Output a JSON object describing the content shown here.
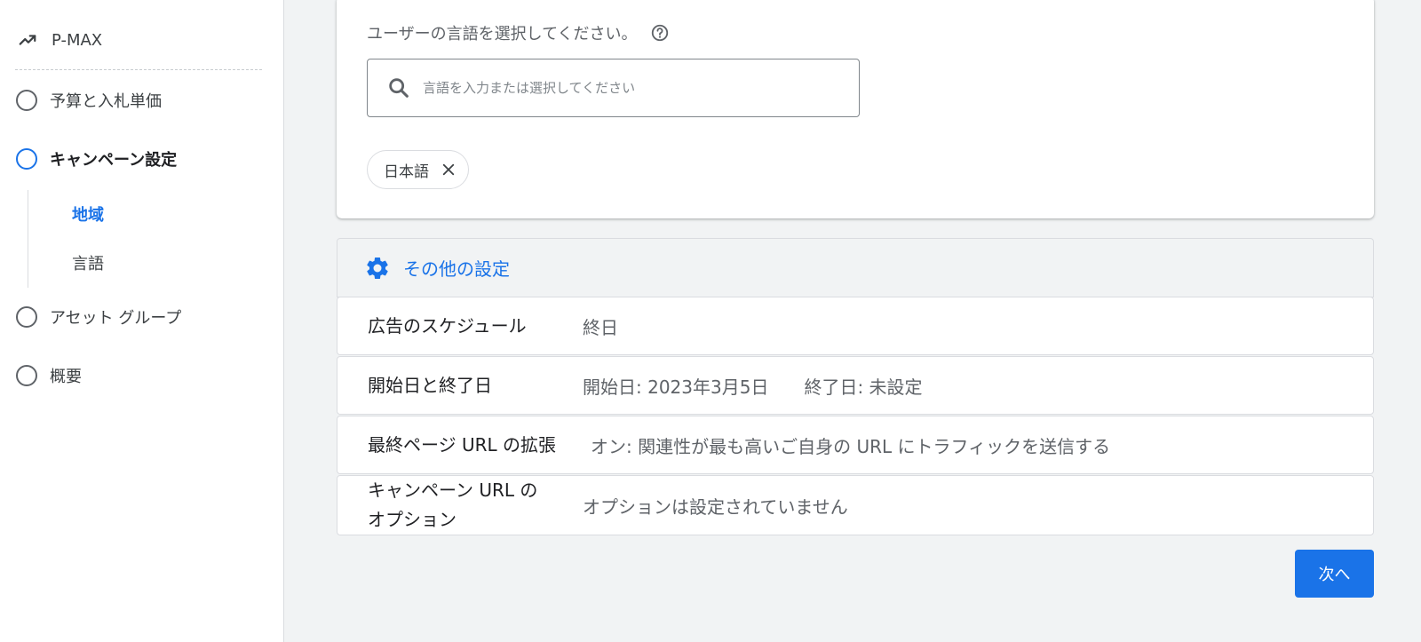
{
  "sidebar": {
    "brand": {
      "label": "P-MAX",
      "icon": "trending-icon"
    },
    "steps": [
      {
        "label": "予算と入札単価",
        "state": "pending"
      },
      {
        "label": "キャンペーン設定",
        "state": "active"
      },
      {
        "label": "アセット グループ",
        "state": "pending"
      },
      {
        "label": "概要",
        "state": "pending"
      }
    ],
    "substeps": [
      {
        "label": "地域",
        "active": true
      },
      {
        "label": "言語",
        "active": false
      }
    ]
  },
  "language": {
    "prompt": "ユーザーの言語を選択してください。",
    "search_placeholder": "言語を入力または選択してください",
    "selected": [
      {
        "label": "日本語"
      }
    ]
  },
  "other_settings": {
    "title": "その他の設定",
    "rows": [
      {
        "label": "広告のスケジュール",
        "value": "終日"
      },
      {
        "label": "開始日と終了日",
        "start": "開始日: 2023年3月5日",
        "end": "終了日: 未設定"
      },
      {
        "label": "最終ページ URL の拡張",
        "value": "オン: 関連性が最も高いご自身の URL にトラフィックを送信する"
      },
      {
        "label_line1": "キャンペーン URL の",
        "label_line2": "オプション",
        "value": "オプションは設定されていません"
      }
    ]
  },
  "actions": {
    "next_label": "次へ"
  },
  "colors": {
    "accent": "#1a73e8",
    "text": "#3c4043",
    "muted": "#5f6368",
    "border": "#dadce0",
    "background": "#f1f3f4"
  }
}
